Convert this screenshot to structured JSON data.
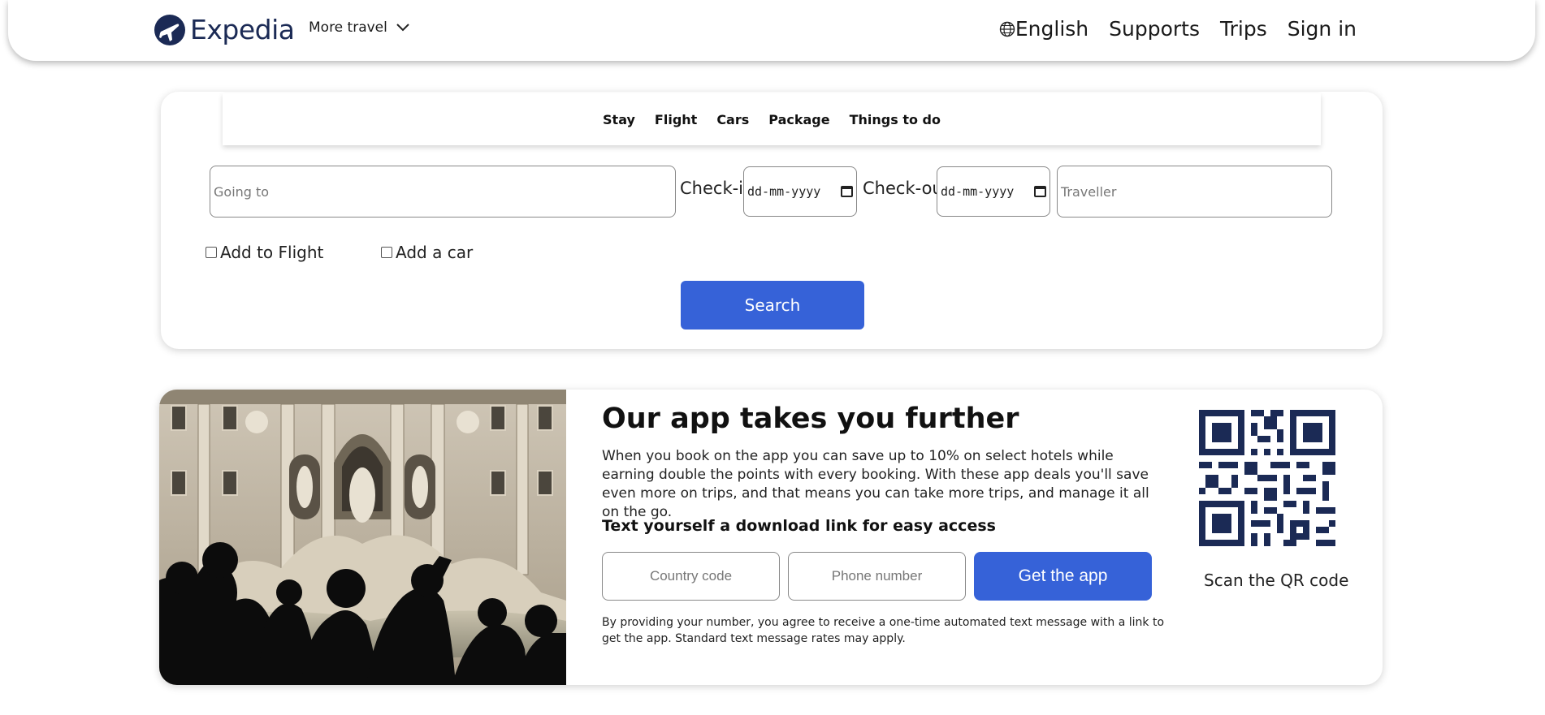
{
  "header": {
    "brand": "Expedia",
    "more_travel": "More travel",
    "language": "English",
    "links": [
      "Supports",
      "Trips",
      "Sign in"
    ]
  },
  "search": {
    "tabs": [
      "Stay",
      "Flight",
      "Cars",
      "Package",
      "Things to do"
    ],
    "going_to_placeholder": "Going to",
    "checkin_label": "Check-in",
    "checkin_value": "dd-mm-yyyy",
    "checkout_label": "Check-out",
    "checkout_value": "dd-mm-yyyy",
    "traveller_placeholder": "Traveller",
    "add_flight": "Add to Flight",
    "add_car": "Add a car",
    "search_button": "Search"
  },
  "app_promo": {
    "title": "Our app takes you further",
    "description": "When you book on the app you can save up to 10% on select hotels while earning double the points with every booking. With these app deals you'll save even more on trips, and that means you can take more trips, and manage it all on the go.",
    "subtitle": "Text yourself a download link for easy access",
    "country_code_placeholder": "Country code",
    "phone_placeholder": "Phone number",
    "get_app_button": "Get the app",
    "disclaimer": "By providing your number, you agree to receive a one-time automated text message with a link to get the app. Standard text message rates may apply.",
    "qr_caption": "Scan the QR code"
  },
  "colors": {
    "brand_navy": "#1b2a55",
    "button_blue": "#3662d8"
  }
}
